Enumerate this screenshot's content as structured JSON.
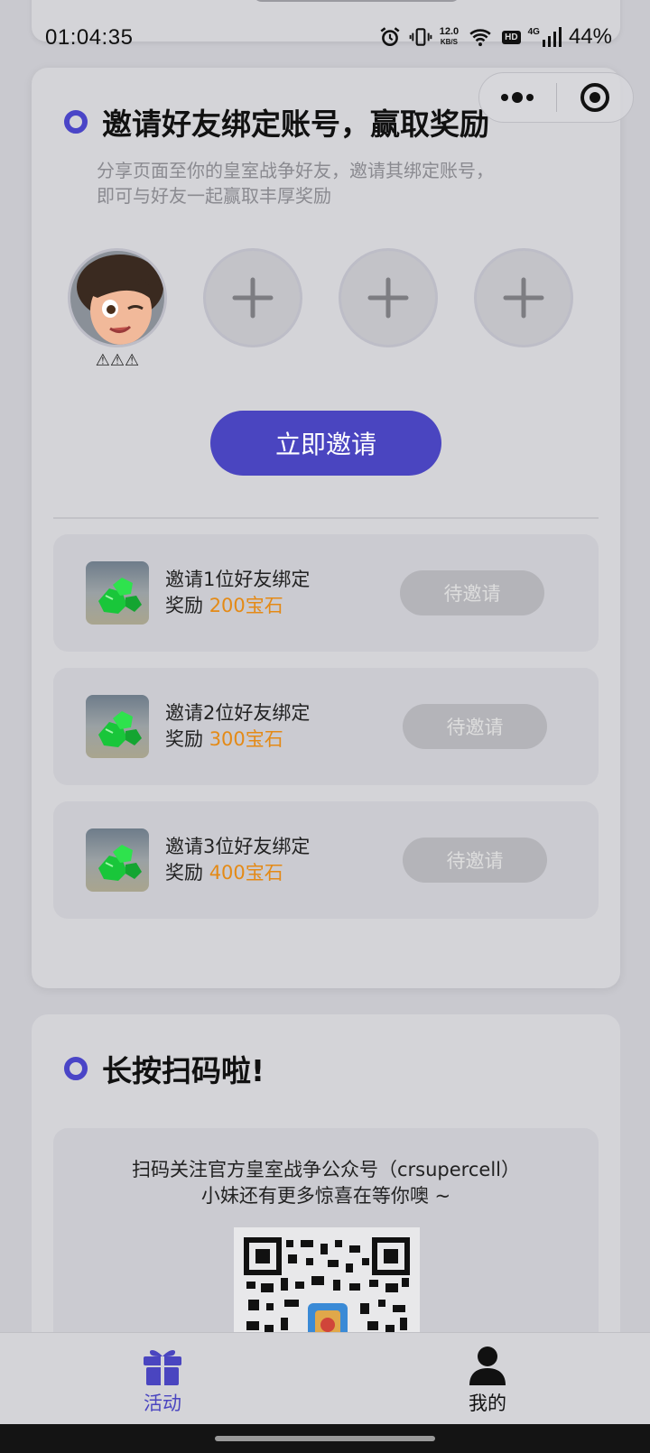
{
  "status_bar": {
    "time": "01:04:35",
    "net_speed_value": "12.0",
    "net_speed_unit": "KB/S",
    "hd": "HD",
    "signal_type": "4G",
    "battery": "44%"
  },
  "invite_section": {
    "title": "邀请好友绑定账号，赢取奖励",
    "description_line1": "分享页面至你的皇室战争好友，邀请其绑定账号，",
    "description_line2": "即可与好友一起赢取丰厚奖励",
    "avatar_name": "⚠⚠⚠",
    "invite_button": "立即邀请",
    "rewards": [
      {
        "line1": "邀请1位好友绑定",
        "prefix": "奖励",
        "amount": "200宝石",
        "status": "待邀请"
      },
      {
        "line1": "邀请2位好友绑定",
        "prefix": "奖励",
        "amount": "300宝石",
        "status": "待邀请"
      },
      {
        "line1": "邀请3位好友绑定",
        "prefix": "奖励",
        "amount": "400宝石",
        "status": "待邀请"
      }
    ]
  },
  "qr_section": {
    "title": "长按扫码啦!",
    "line1": "扫码关注官方皇室战争公众号（crsupercell）",
    "line2": "小妹还有更多惊喜在等你噢 ~"
  },
  "bottom_nav": {
    "items": [
      {
        "label": "活动",
        "icon": "gift-icon",
        "active": true
      },
      {
        "label": "我的",
        "icon": "user-icon",
        "active": false
      }
    ]
  },
  "colors": {
    "accent": "#4a45c0",
    "reward_amount": "#e48a16",
    "card_bg": "#d4d4d8"
  }
}
